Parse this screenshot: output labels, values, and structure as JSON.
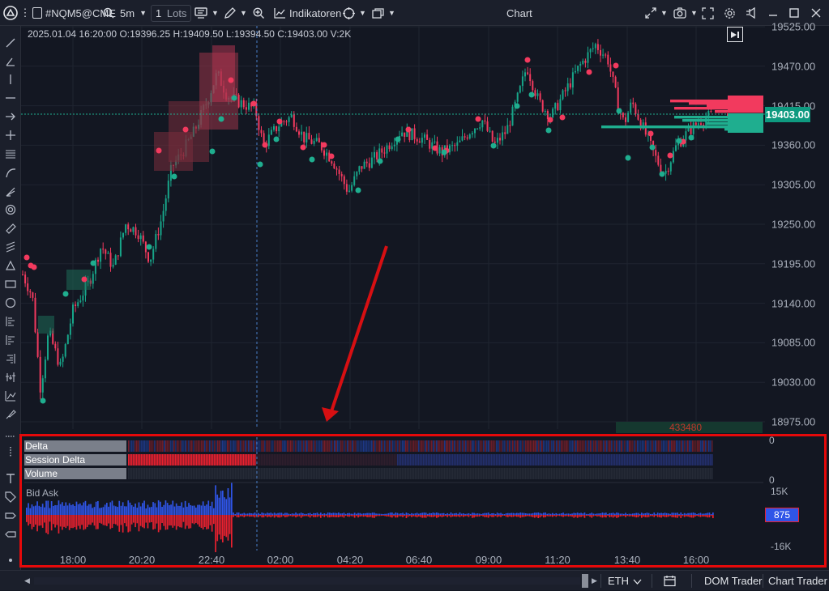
{
  "header": {
    "symbol": "#NQM5@CME",
    "timeframe": "5m",
    "lots_value": "1",
    "lots_label": "Lots",
    "indicators_label": "Indikatoren",
    "window_title": "Chart"
  },
  "ohlc_text": "2025.01.04 16:20:00 O:19396.25 H:19409.50 L:19394.50 C:19403.00 V:2K",
  "price_axis": {
    "labels": [
      "19525.00",
      "19470.00",
      "19415.00",
      "19360.00",
      "19305.00",
      "19250.00",
      "19195.00",
      "19140.00",
      "19085.00",
      "19030.00",
      "18975.00"
    ],
    "current_price": "19403.00"
  },
  "volume_annotation": "433480",
  "indicators": {
    "delta_label": "Delta",
    "session_delta_label": "Session Delta",
    "volume_label": "Volume",
    "bid_ask_label": "Bid Ask",
    "upper_axis_top": "0",
    "upper_axis_bottom": "0",
    "lower_axis_top": "15K",
    "lower_axis_bottom": "-16K",
    "bid_ask_value": "875"
  },
  "time_axis": [
    "18:00",
    "20:20",
    "22:40",
    "02:00",
    "04:20",
    "06:40",
    "09:00",
    "11:20",
    "13:40",
    "16:00"
  ],
  "bottom": {
    "eth_label": "ETH",
    "dom_trader_label": "DOM Trader",
    "chart_trader_label": "Chart Trader"
  },
  "chart_data": {
    "type": "candlestick",
    "x": [
      "18:00",
      "20:20",
      "22:40",
      "02:00",
      "04:20",
      "06:40",
      "09:00",
      "11:20",
      "13:40",
      "16:00"
    ],
    "close": [
      19090,
      19240,
      19420,
      19390,
      19310,
      19380,
      19410,
      19460,
      19350,
      19403
    ],
    "ylim": [
      18950,
      19535
    ],
    "colors": {
      "up": "#17a589",
      "down": "#f23a5e",
      "bid": "#2f55e8",
      "ask": "#e8212f"
    }
  }
}
